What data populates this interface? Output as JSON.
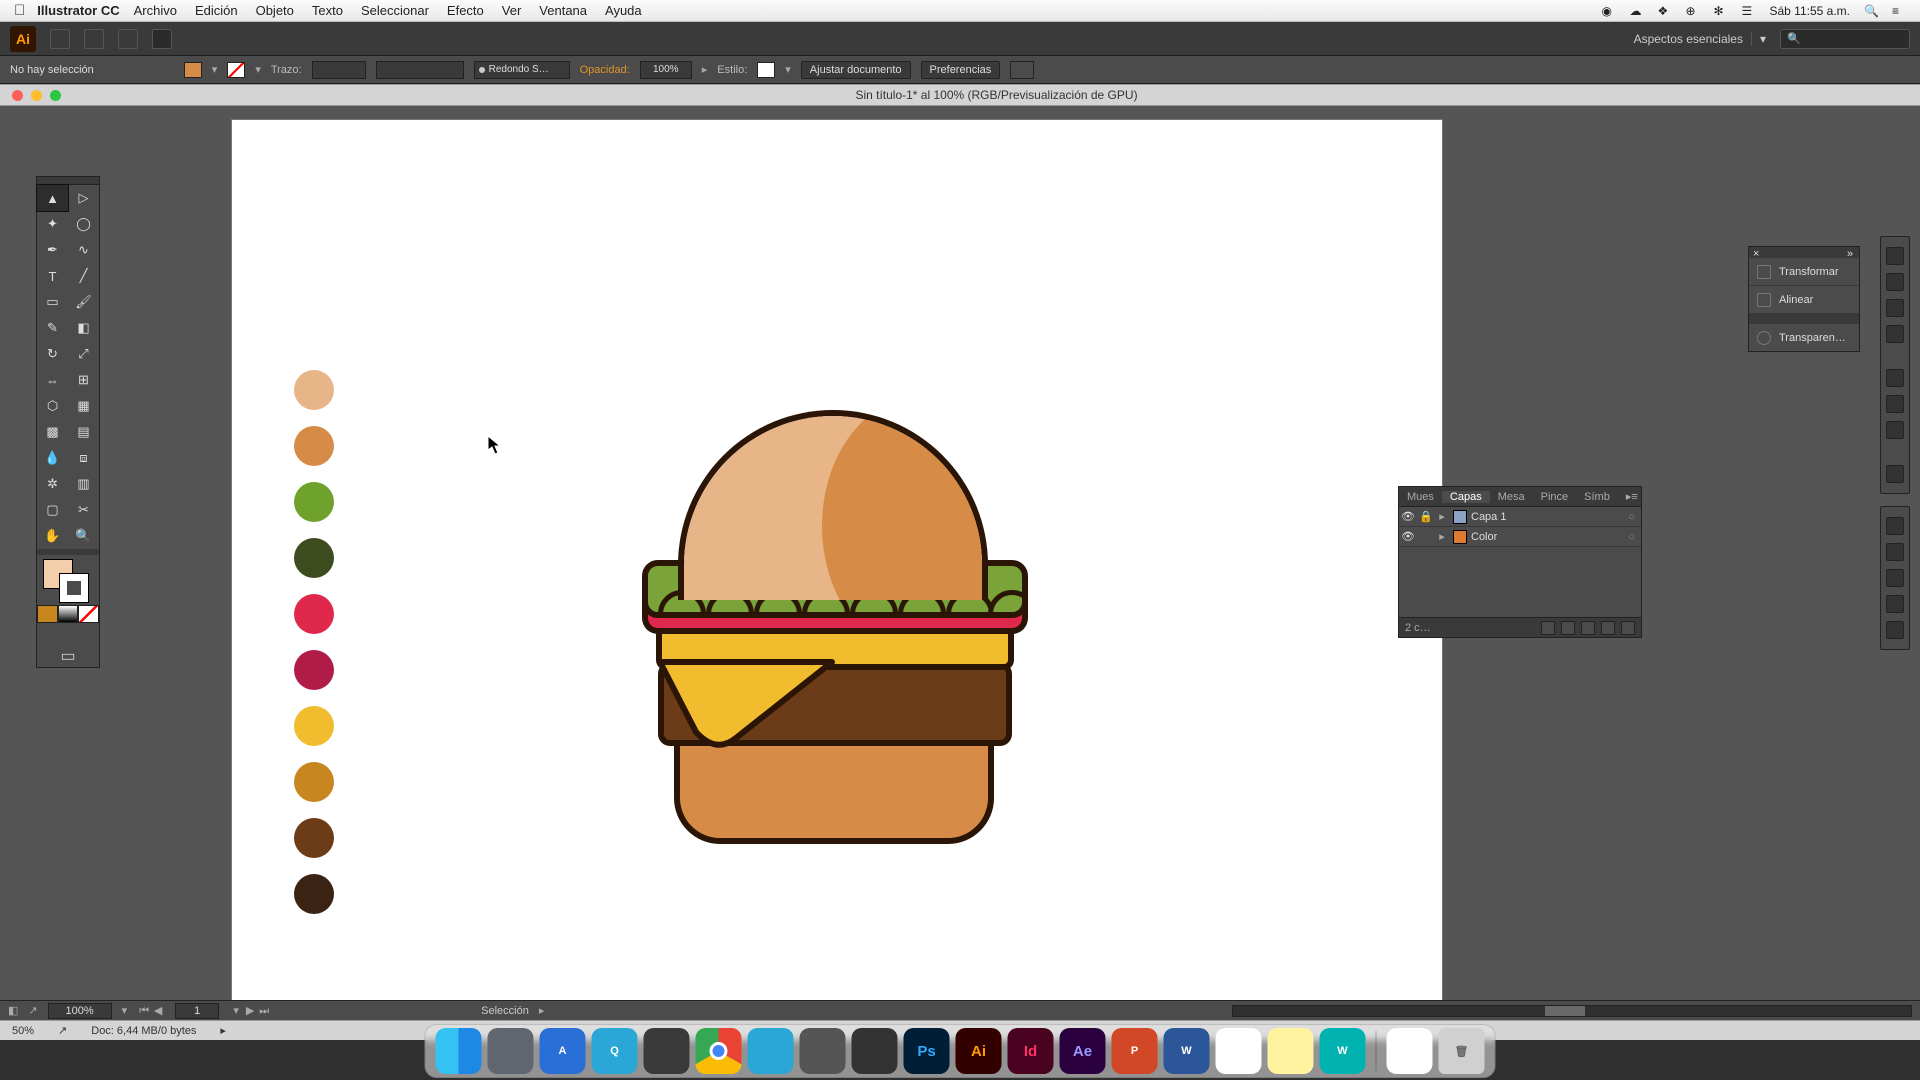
{
  "mac_menu": {
    "app": "Illustrator CC",
    "items": [
      "Archivo",
      "Edición",
      "Objeto",
      "Texto",
      "Seleccionar",
      "Efecto",
      "Ver",
      "Ventana",
      "Ayuda"
    ],
    "time": "Sáb 11:55 a.m."
  },
  "workspace": {
    "label": "Aspectos esenciales"
  },
  "control_bar": {
    "no_selection": "No hay selección",
    "trazo": "Trazo:",
    "cap_label": "Redondo S…",
    "opacity_label": "Opacidad:",
    "opacity_value": "100%",
    "estilo": "Estilo:",
    "ajustar": "Ajustar documento",
    "prefs": "Preferencias"
  },
  "document": {
    "title": "Sin título-1* al 100% (RGB/Previsualización de GPU)"
  },
  "statusbar": {
    "zoom": "100%",
    "artboard": "1",
    "mode": "Selección"
  },
  "docstrip": {
    "zoom2": "50%",
    "info": "Doc: 6,44 MB/0 bytes"
  },
  "palette": [
    "#e8b589",
    "#d68c46",
    "#6fa22d",
    "#3c4c1f",
    "#e0274c",
    "#b01c47",
    "#f2bc2f",
    "#c7861f",
    "#6b3c17",
    "#3a2312"
  ],
  "burger_colors": {
    "bun": "#e8b589",
    "bun_shadow": "#d68c46",
    "lettuce": "#7aa33a",
    "lettuce_dark": "#5c7f2c",
    "tomato": "#e0274c",
    "cheese": "#f2bc2f",
    "patty": "#6b3c17",
    "outline": "#2a1506"
  },
  "panelgrp": {
    "transform": "Transformar",
    "align": "Alinear",
    "transparency": "Transparen…"
  },
  "layers": {
    "tabs": [
      "Mues",
      "Capas",
      "Mesa",
      "Pince",
      "Símb"
    ],
    "active_tab": 1,
    "rows": [
      {
        "name": "Capa 1",
        "chip": "#8aa3c2"
      },
      {
        "name": "Color",
        "chip": "#e07a2f"
      }
    ],
    "footer": "2 c…"
  },
  "dock_apps": [
    {
      "bg": "#c9d4e0",
      "txt": "",
      "name": "finder"
    },
    {
      "bg": "#606670",
      "txt": "",
      "name": "launchpad"
    },
    {
      "bg": "#2a6fd6",
      "txt": "A",
      "name": "appstore"
    },
    {
      "bg": "#2aa7d6",
      "txt": "Q",
      "name": "quicktime"
    },
    {
      "bg": "#3a3a3a",
      "txt": "",
      "name": "filmstrip"
    },
    {
      "bg": "#ffffff",
      "txt": "",
      "name": "chrome"
    },
    {
      "bg": "#2aa7d6",
      "txt": "",
      "name": "safari"
    },
    {
      "bg": "#555555",
      "txt": "",
      "name": "settings"
    },
    {
      "bg": "#333333",
      "txt": "",
      "name": "c4d"
    },
    {
      "bg": "#001e36",
      "txt": "Ps",
      "name": "photoshop"
    },
    {
      "bg": "#330000",
      "txt": "Ai",
      "name": "illustrator"
    },
    {
      "bg": "#49021f",
      "txt": "Id",
      "name": "indesign"
    },
    {
      "bg": "#2a003f",
      "txt": "Ae",
      "name": "aftereffects"
    },
    {
      "bg": "#d24726",
      "txt": "P",
      "name": "powerpoint"
    },
    {
      "bg": "#2b579a",
      "txt": "W",
      "name": "word"
    },
    {
      "bg": "#ffffff",
      "txt": "",
      "name": "preview"
    },
    {
      "bg": "#fff3a0",
      "txt": "",
      "name": "notes"
    },
    {
      "bg": "#00b3b0",
      "txt": "W",
      "name": "wps"
    },
    {
      "bg": "#ffffff",
      "txt": "",
      "name": "doc"
    },
    {
      "bg": "#d0d0d0",
      "txt": "",
      "name": "trash"
    }
  ],
  "tool_fill_color": "#f2ceab"
}
